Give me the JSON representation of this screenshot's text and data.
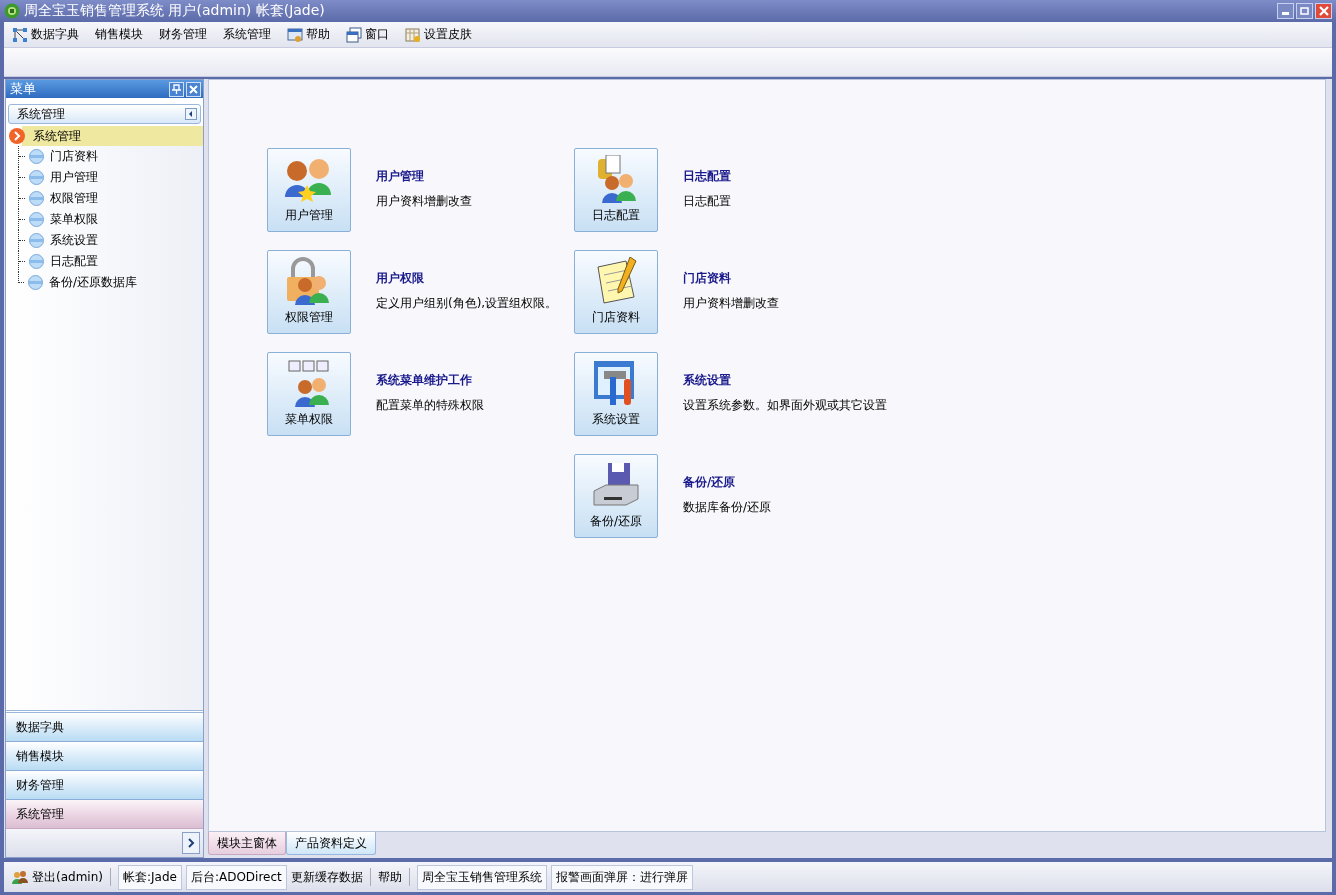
{
  "window": {
    "title": "周全宝玉销售管理系统 用户(admin) 帐套(Jade)"
  },
  "menu": [
    {
      "label": "数据字典",
      "kind": "network"
    },
    {
      "label": "销售模块",
      "kind": "text"
    },
    {
      "label": "财务管理",
      "kind": "text"
    },
    {
      "label": "系统管理",
      "kind": "text"
    },
    {
      "label": "帮助",
      "kind": "help"
    },
    {
      "label": "窗口",
      "kind": "window"
    },
    {
      "label": "设置皮肤",
      "kind": "skin"
    }
  ],
  "sidebar": {
    "title": "菜单",
    "group_header": "系统管理",
    "tree": {
      "label": "系统管理",
      "selected": true,
      "children": [
        {
          "label": "门店资料",
          "selected": false
        },
        {
          "label": "用户管理",
          "selected": false
        },
        {
          "label": "权限管理",
          "selected": false
        },
        {
          "label": "菜单权限",
          "selected": false
        },
        {
          "label": "系统设置",
          "selected": false
        },
        {
          "label": "日志配置",
          "selected": false
        },
        {
          "label": "备份/还原数据库",
          "selected": false
        }
      ]
    },
    "nav_buttons": [
      {
        "label": "数据字典",
        "selected": false
      },
      {
        "label": "销售模块",
        "selected": false
      },
      {
        "label": "财务管理",
        "selected": false
      },
      {
        "label": "系统管理",
        "selected": true
      }
    ]
  },
  "modules": [
    [
      {
        "button_label": "用户管理",
        "title": "用户管理",
        "description": "用户资料增删改查",
        "kind": "users"
      },
      {
        "button_label": "权限管理",
        "title": "用户权限",
        "description": "定义用户组别(角色),设置组权限。",
        "kind": "lock"
      },
      {
        "button_label": "菜单权限",
        "title": "系统菜单维护工作",
        "description": "配置菜单的特殊权限",
        "kind": "menus"
      }
    ],
    [
      {
        "button_label": "日志配置",
        "title": "日志配置",
        "description": "日志配置",
        "kind": "log"
      },
      {
        "button_label": "门店资料",
        "title": "门店资料",
        "description": "用户资料增删改查",
        "kind": "notepad"
      },
      {
        "button_label": "系统设置",
        "title": "系统设置",
        "description": "设置系统参数。如界面外观或其它设置",
        "kind": "tools"
      },
      {
        "button_label": "备份/还原",
        "title": "备份/还原",
        "description": "数据库备份/还原",
        "kind": "disk"
      }
    ]
  ],
  "tabs": [
    {
      "label": "模块主窗体",
      "selected": true
    },
    {
      "label": "产品资料定义",
      "selected": false
    }
  ],
  "status_bar": [
    {
      "label": "登出(admin)",
      "kind": "user"
    },
    {
      "label": "帐套:Jade",
      "kind": "boxed"
    },
    {
      "label": "后台:ADODirect",
      "kind": "boxed"
    },
    {
      "label": "更新缓存数据",
      "kind": "plain"
    },
    {
      "label": "帮助",
      "kind": "plain"
    },
    {
      "label": "周全宝玉销售管理系统",
      "kind": "boxed"
    },
    {
      "label": "报警画面弹屏：进行弹屏",
      "kind": "boxed"
    }
  ]
}
